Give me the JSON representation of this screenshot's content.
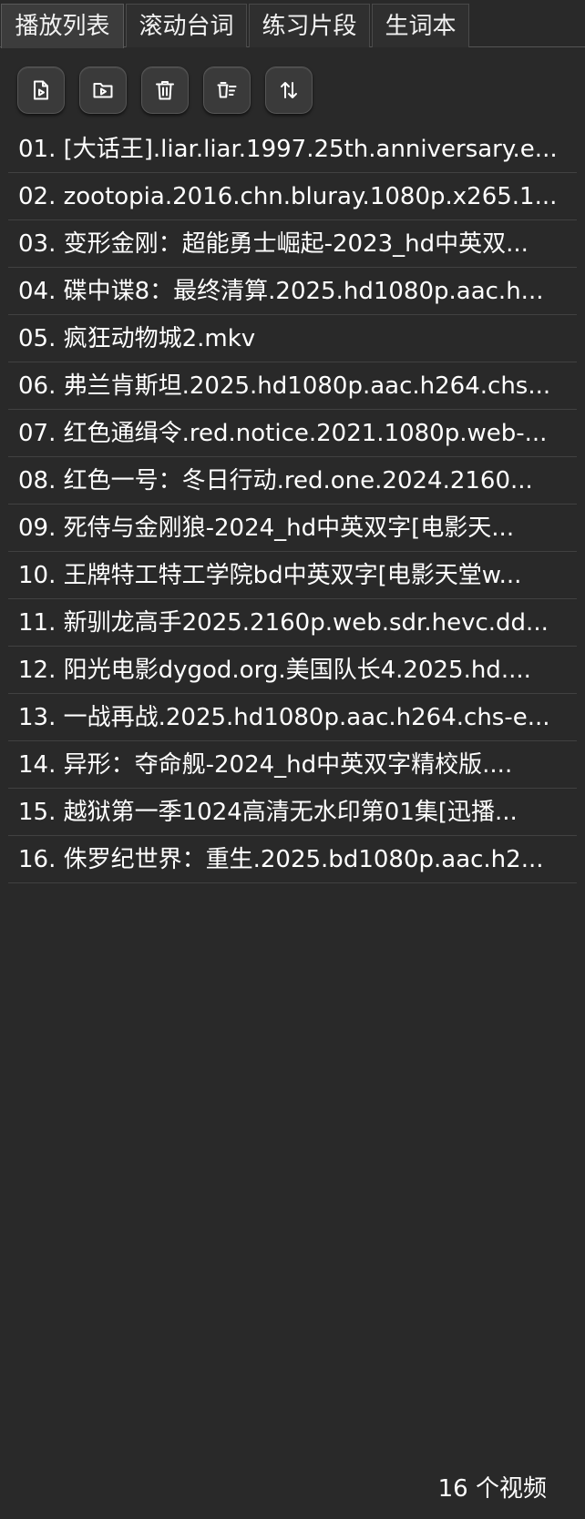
{
  "tabs": [
    "播放列表",
    "滚动台词",
    "练习片段",
    "生词本"
  ],
  "toolbar": {
    "icons": [
      "add-video-file-icon",
      "add-video-folder-icon",
      "delete-icon",
      "clear-list-icon",
      "sort-icon"
    ]
  },
  "playlist": [
    "01. [大话王].liar.liar.1997.25th.anniversary.e...",
    "02. zootopia.2016.chn.bluray.1080p.x265.1...",
    "03. 变形金刚：超能勇士崛起-2023_hd中英双...",
    "04. 碟中谍8：最终清算.2025.hd1080p.aac.h...",
    "05. 疯狂动物城2.mkv",
    "06. 弗兰肯斯坦.2025.hd1080p.aac.h264.chs...",
    "07. 红色通缉令.red.notice.2021.1080p.web-...",
    "08. 红色一号：冬日行动.red.one.2024.2160...",
    "09. 死侍与金刚狼-2024_hd中英双字[电影天...",
    "10. 王牌特工特工学院bd中英双字[电影天堂w...",
    "11. 新驯龙高手2025.2160p.web.sdr.hevc.dd...",
    "12. 阳光电影dygod.org.美国队长4.2025.hd....",
    "13. 一战再战.2025.hd1080p.aac.h264.chs-e...",
    "14. 异形：夺命舰-2024_hd中英双字精校版....",
    "15. 越狱第一季1024高清无水印第01集[迅播...",
    "16. 侏罗纪世界：重生.2025.bd1080p.aac.h2..."
  ],
  "footer": {
    "count_text": "16 个视频"
  }
}
